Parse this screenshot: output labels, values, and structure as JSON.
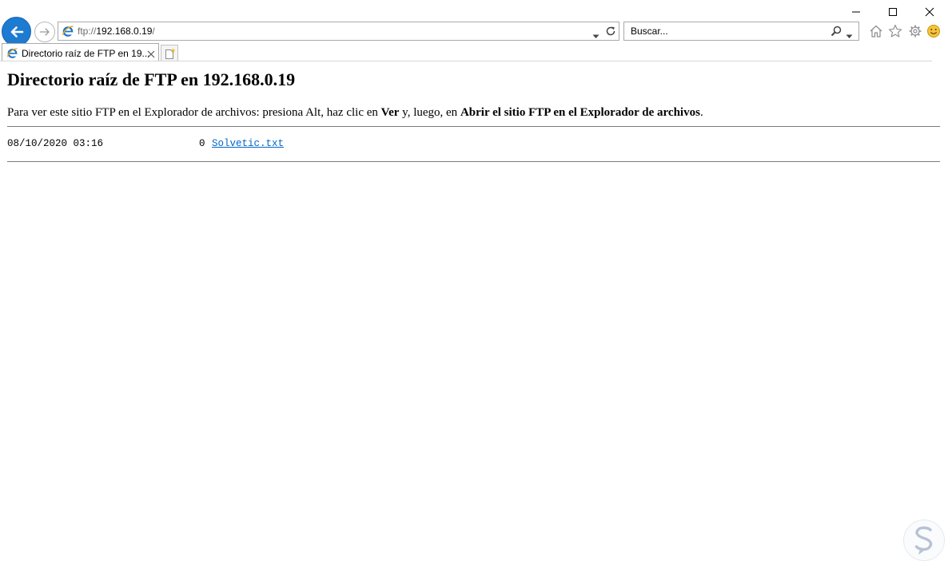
{
  "browser": {
    "address": {
      "protocol": "ftp://",
      "host": "192.168.0.19",
      "tail": "/"
    },
    "search": {
      "placeholder": "Buscar..."
    },
    "tab": {
      "title": "Directorio raíz de FTP en 19..."
    },
    "icons": {
      "back": "back-arrow-icon",
      "forward": "forward-arrow-icon",
      "home": "home-icon",
      "favorites": "star-icon",
      "tools": "gear-icon",
      "feedback": "smiley-icon"
    },
    "colors": {
      "back_button": "#1d7bd1",
      "link": "#0066cc"
    }
  },
  "page": {
    "title": "Directorio raíz de FTP en 192.168.0.19",
    "instructions": {
      "part1": "Para ver este sitio FTP en el Explorador de archivos: presiona Alt, haz clic en ",
      "bold1": "Ver",
      "part2": " y, luego, en ",
      "bold2": "Abrir el sitio FTP en el Explorador de archivos",
      "part3": "."
    },
    "listing": [
      {
        "date": "08/10/2020 03:16",
        "size": "0",
        "name": "Solvetic.txt"
      }
    ]
  }
}
